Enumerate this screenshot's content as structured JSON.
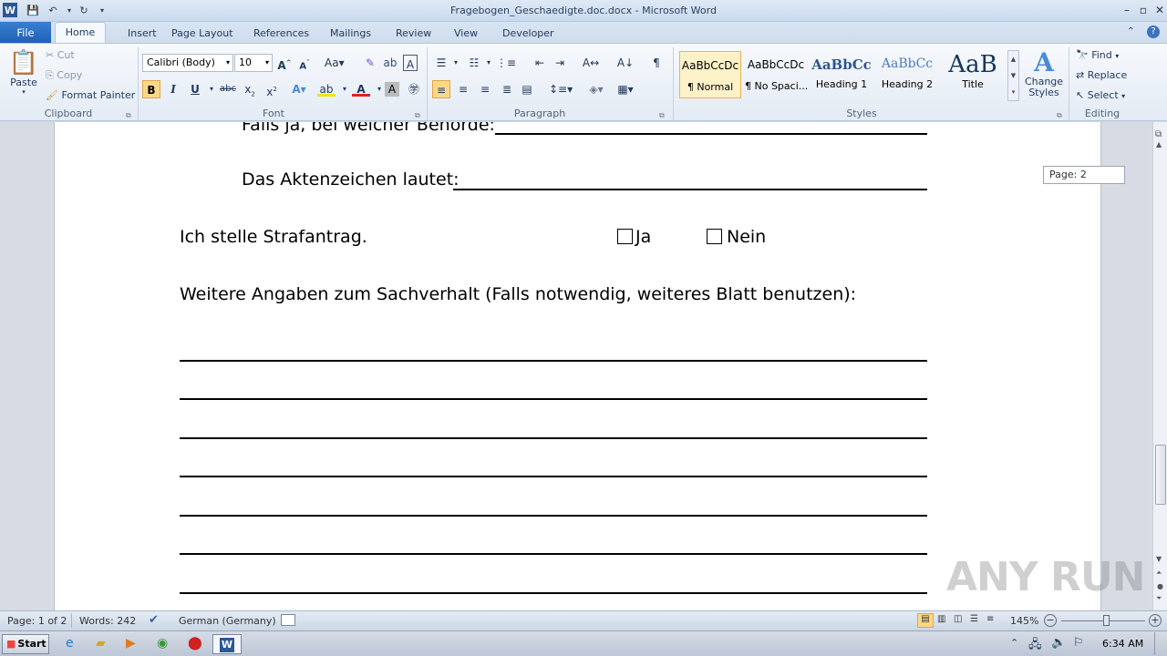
{
  "window": {
    "title": "Fragebogen_Geschaedigte.doc.docx - Microsoft Word"
  },
  "tabs": [
    "File",
    "Home",
    "Insert",
    "Page Layout",
    "References",
    "Mailings",
    "Review",
    "View",
    "Developer"
  ],
  "clipboard": {
    "paste": "Paste",
    "cut": "Cut",
    "copy": "Copy",
    "format_painter": "Format Painter",
    "label": "Clipboard"
  },
  "font": {
    "name": "Calibri (Body)",
    "size": "10",
    "label": "Font"
  },
  "paragraph": {
    "label": "Paragraph"
  },
  "styles": {
    "label": "Styles",
    "items": [
      {
        "preview": "AaBbCcDc",
        "name": "¶ Normal"
      },
      {
        "preview": "AaBbCcDc",
        "name": "¶ No Spaci..."
      },
      {
        "preview": "AaBbCc",
        "name": "Heading 1"
      },
      {
        "preview": "AaBbCc",
        "name": "Heading 2"
      },
      {
        "preview": "AaB",
        "name": "Title"
      }
    ],
    "change_styles": "Change Styles"
  },
  "editing": {
    "find": "Find",
    "replace": "Replace",
    "select": "Select",
    "label": "Editing"
  },
  "document": {
    "partial_line": "Falls ja, bei welcher Behörde:",
    "aktenzeichen": "Das Aktenzeichen lautet:",
    "strafantrag": "Ich stelle Strafantrag.",
    "ja": "Ja",
    "nein": "Nein",
    "weitere": "Weitere Angaben zum Sachverhalt (Falls notwendig, weiteres Blatt benutzen):"
  },
  "page_tip": "Page: 2",
  "status": {
    "page": "Page: 1 of 2",
    "words": "Words: 242",
    "language": "German (Germany)",
    "zoom": "145%"
  },
  "taskbar": {
    "start": "Start",
    "time": "6:34 AM"
  },
  "watermark": "ANY RUN"
}
